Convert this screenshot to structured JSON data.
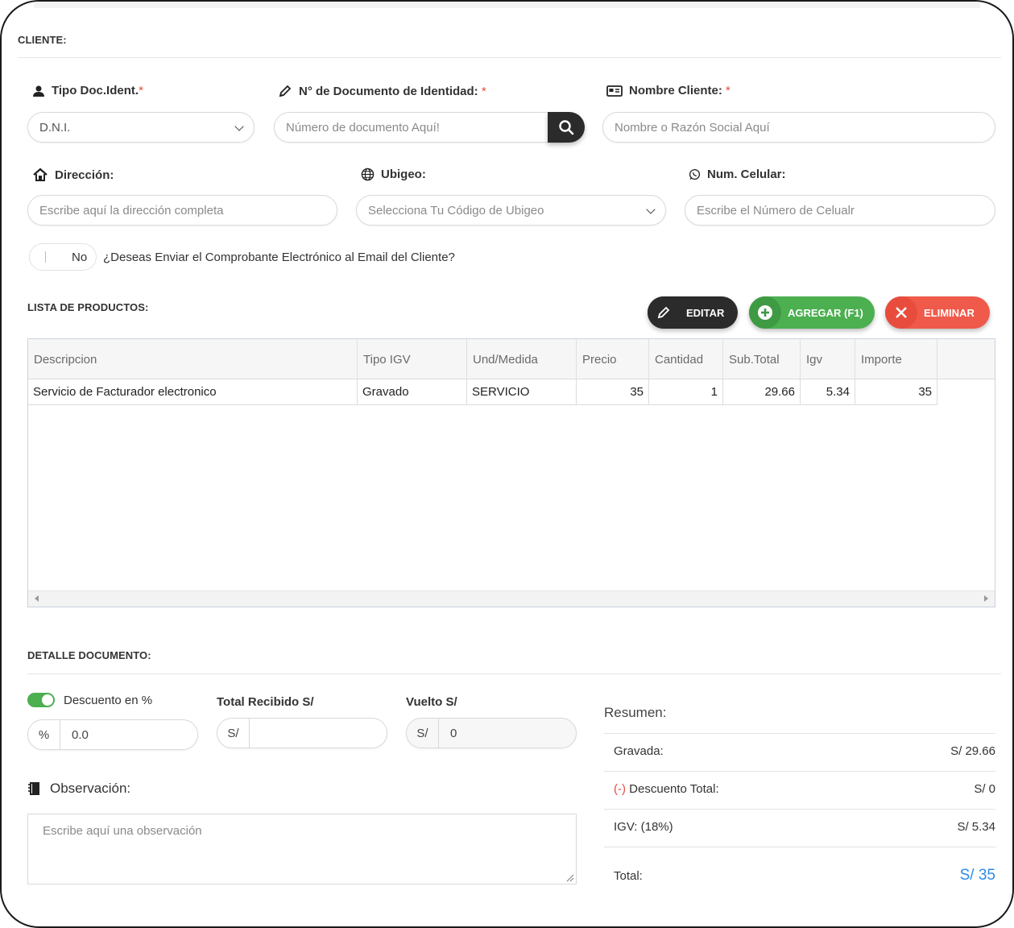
{
  "cliente": {
    "section_title": "CLIENTE:",
    "tipo_doc": {
      "label": "Tipo Doc.Ident.",
      "required_mark": "*",
      "value": "D.N.I."
    },
    "num_doc": {
      "label": "N° de Documento de Identidad:",
      "required_mark": "*",
      "placeholder": "Número de documento Aquí!"
    },
    "nombre": {
      "label": "Nombre Cliente:",
      "required_mark": "*",
      "placeholder": "Nombre o Razón Social Aquí"
    },
    "direccion": {
      "label": "Dirección:",
      "placeholder": "Escribe aquí la dirección completa"
    },
    "ubigeo": {
      "label": "Ubigeo:",
      "placeholder": "Selecciona Tu Código de Ubigeo"
    },
    "celular": {
      "label": "Num. Celular:",
      "placeholder": "Escribe el Número de Celualr"
    },
    "email_toggle": {
      "state": "No",
      "question": "¿Deseas Enviar el Comprobante Electrónico al Email del Cliente?"
    }
  },
  "productos": {
    "section_title": "LISTA DE PRODUCTOS:",
    "buttons": {
      "editar": "EDITAR",
      "agregar": "AGREGAR (F1)",
      "eliminar": "ELIMINAR"
    },
    "columns": [
      "Descripcion",
      "Tipo IGV",
      "Und/Medida",
      "Precio",
      "Cantidad",
      "Sub.Total",
      "Igv",
      "Importe"
    ],
    "rows": [
      [
        "Servicio de Facturador electronico",
        "Gravado",
        "SERVICIO",
        "35",
        "1",
        "29.66",
        "5.34",
        "35"
      ]
    ]
  },
  "detalle": {
    "section_title": "DETALLE DOCUMENTO:",
    "descuento": {
      "label": "Descuento en %",
      "enabled": true,
      "addon": "%",
      "value": "0.0"
    },
    "total_recibido": {
      "label": "Total Recibido S/",
      "addon": "S/",
      "value": ""
    },
    "vuelto": {
      "label": "Vuelto S/",
      "addon": "S/",
      "value": "0"
    },
    "observacion": {
      "label": "Observación:",
      "placeholder": "Escribe aquí una observación"
    }
  },
  "resumen": {
    "title": "Resumen:",
    "gravada_label": "Gravada:",
    "gravada_value": "S/ 29.66",
    "descuento_prefix": "(-)",
    "descuento_label": "Descuento Total:",
    "descuento_value": "S/ 0",
    "igv_label": "IGV:",
    "igv_rate": "(18%)",
    "igv_value": "S/ 5.34",
    "total_label": "Total:",
    "total_value": "S/ 35"
  },
  "colors": {
    "accent_green": "#4caf50",
    "danger_red": "#e74c3c",
    "dark": "#2b2b2b",
    "total_blue": "#2e8be6"
  }
}
